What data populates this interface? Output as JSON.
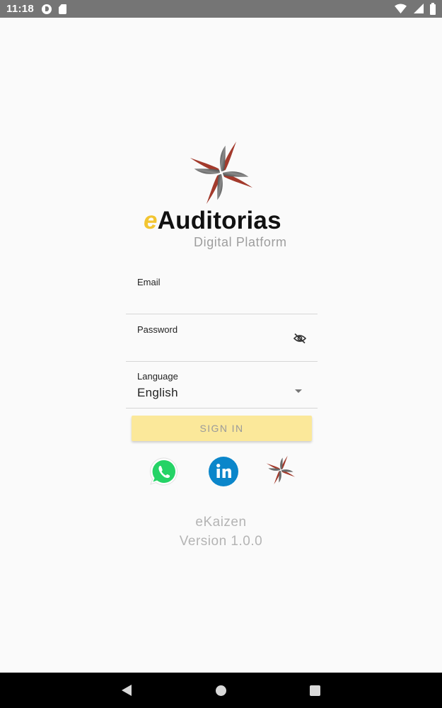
{
  "status_bar": {
    "time": "11:18",
    "icons": [
      "app-notification-icon",
      "sd-card-icon",
      "wifi-icon",
      "cell-signal-icon",
      "battery-icon"
    ]
  },
  "brand": {
    "prefix": "e",
    "name": "Auditorias",
    "subtitle": "Digital Platform",
    "logo_colors": [
      "#a33a2c",
      "#5a5a5a"
    ],
    "accent": "#f2c531"
  },
  "form": {
    "email": {
      "label": "Email",
      "value": ""
    },
    "password": {
      "label": "Password",
      "value": "",
      "toggle_icon": "eye-off-icon"
    },
    "language": {
      "label": "Language",
      "value": "English"
    },
    "signin_label": "SIGN IN",
    "signin_color": "#fbe89a"
  },
  "social": {
    "items": [
      "whatsapp-icon",
      "linkedin-icon",
      "website-icon"
    ],
    "colors": {
      "whatsapp": "#25d366",
      "linkedin": "#0b86ca"
    }
  },
  "footer": {
    "app_name": "eKaizen",
    "version": "Version 1.0.0"
  },
  "nav_bar": {
    "buttons": [
      "back-icon",
      "home-icon",
      "recents-icon"
    ]
  }
}
